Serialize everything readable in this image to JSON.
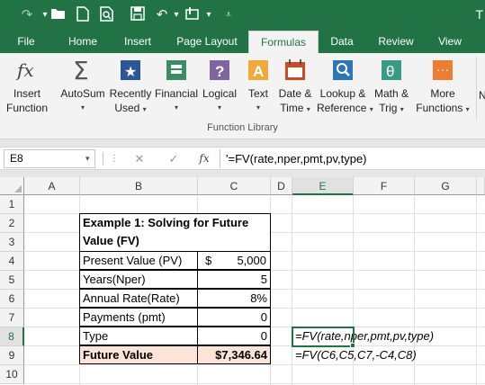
{
  "qat": {
    "icons": [
      "redo-icon",
      "open-folder-icon",
      "new-file-icon",
      "print-preview-icon",
      "save-icon",
      "undo-icon",
      "touch-mode-icon",
      "customize-qat-icon"
    ],
    "title_fragment": "T"
  },
  "tabs": [
    {
      "label": "File"
    },
    {
      "label": "Home"
    },
    {
      "label": "Insert"
    },
    {
      "label": "Page Layout"
    },
    {
      "label": "Formulas",
      "active": true
    },
    {
      "label": "Data"
    },
    {
      "label": "Review"
    },
    {
      "label": "View"
    }
  ],
  "ribbon": {
    "group_label": "Function Library",
    "buttons": [
      {
        "line1": "Insert",
        "line2": "Function",
        "icon": "insert-function-icon"
      },
      {
        "line1": "AutoSum",
        "line2": "",
        "icon": "autosum-icon",
        "caret": true
      },
      {
        "line1": "Recently",
        "line2": "Used",
        "icon": "recently-used-icon",
        "caret": true
      },
      {
        "line1": "Financial",
        "line2": "",
        "icon": "financial-icon",
        "caret": true
      },
      {
        "line1": "Logical",
        "line2": "",
        "icon": "logical-icon",
        "caret": true
      },
      {
        "line1": "Text",
        "line2": "",
        "icon": "text-icon",
        "caret": true
      },
      {
        "line1": "Date &",
        "line2": "Time",
        "icon": "date-time-icon",
        "caret": true
      },
      {
        "line1": "Lookup &",
        "line2": "Reference",
        "icon": "lookup-reference-icon",
        "caret": true
      },
      {
        "line1": "Math &",
        "line2": "Trig",
        "icon": "math-trig-icon",
        "caret": true
      },
      {
        "line1": "More",
        "line2": "Functions",
        "icon": "more-functions-icon",
        "caret": true
      }
    ],
    "fragment": "N"
  },
  "formula_bar": {
    "name_box": "E8",
    "fx_label": "fx",
    "formula": "'=FV(rate,nper,pmt,pv,type)"
  },
  "columns": [
    "A",
    "B",
    "C",
    "D",
    "E",
    "F",
    "G"
  ],
  "rows": [
    "1",
    "2",
    "3",
    "4",
    "5",
    "6",
    "7",
    "8",
    "9",
    "10"
  ],
  "selected": {
    "column": "E",
    "row": "8"
  },
  "sheet": {
    "title_line1": "Example 1: Solving for Future",
    "title_line2": "Value (FV)",
    "rows": [
      {
        "label": "Present Value (PV)",
        "currency": "$",
        "value": "5,000"
      },
      {
        "label": "Years(Nper)",
        "currency": "",
        "value": "5"
      },
      {
        "label": "Annual Rate(Rate)",
        "currency": "",
        "value": "8%"
      },
      {
        "label": "Payments (pmt)",
        "currency": "",
        "value": "0"
      },
      {
        "label": "Type",
        "currency": "",
        "value": "0"
      }
    ],
    "result_label": "Future Value",
    "result_value": "$7,346.64",
    "e8_text": "=FV(rate,nper,pmt,pv,type)",
    "e9_text": "=FV(C6,C5,C7,-C4,C8)"
  },
  "colors": {
    "accent": "#217346",
    "result_fill": "#fce4d6"
  }
}
